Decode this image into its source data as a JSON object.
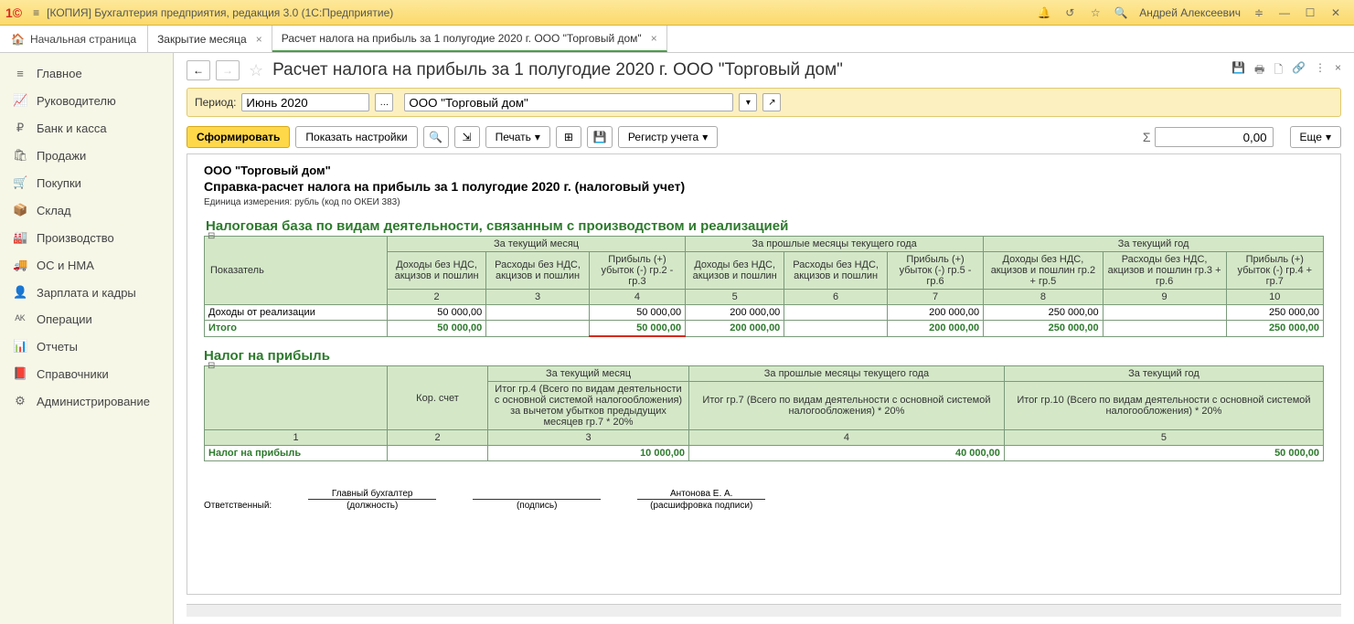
{
  "titlebar": {
    "title": "[КОПИЯ] Бухгалтерия предприятия, редакция 3.0  (1С:Предприятие)",
    "user": "Андрей Алексеевич"
  },
  "tabs": {
    "home": "Начальная страница",
    "items": [
      {
        "label": "Закрытие месяца",
        "active": false
      },
      {
        "label": "Расчет налога на прибыль за 1 полугодие 2020 г. ООО \"Торговый дом\"",
        "active": true
      }
    ]
  },
  "sidebar": [
    {
      "icon": "≡",
      "label": "Главное"
    },
    {
      "icon": "📈",
      "label": "Руководителю"
    },
    {
      "icon": "₽",
      "label": "Банк и касса"
    },
    {
      "icon": "🛍",
      "label": "Продажи"
    },
    {
      "icon": "🛒",
      "label": "Покупки"
    },
    {
      "icon": "📦",
      "label": "Склад"
    },
    {
      "icon": "🏭",
      "label": "Производство"
    },
    {
      "icon": "🚚",
      "label": "ОС и НМА"
    },
    {
      "icon": "👤",
      "label": "Зарплата и кадры"
    },
    {
      "icon": "ᴬᴷ",
      "label": "Операции"
    },
    {
      "icon": "📊",
      "label": "Отчеты"
    },
    {
      "icon": "📕",
      "label": "Справочники"
    },
    {
      "icon": "⚙",
      "label": "Администрирование"
    }
  ],
  "page": {
    "title": "Расчет налога на прибыль за 1 полугодие 2020 г. ООО \"Торговый дом\""
  },
  "filter": {
    "period_label": "Период:",
    "period_value": "Июнь 2020",
    "org_value": "ООО \"Торговый дом\""
  },
  "toolbar": {
    "form": "Сформировать",
    "settings": "Показать настройки",
    "print": "Печать",
    "register": "Регистр учета",
    "sigma_value": "0,00",
    "more": "Еще"
  },
  "report": {
    "org": "ООО \"Торговый дом\"",
    "title": "Справка-расчет налога на прибыль за 1 полугодие 2020 г. (налоговый учет)",
    "unit_label": "Единица измерения:",
    "unit_value": "рубль (код по ОКЕИ 383)",
    "section1": {
      "title": "Налоговая база по видам деятельности, связанным с производством и реализацией",
      "h_indicator": "Показатель",
      "h_cur_month": "За текущий месяц",
      "h_prev_months": "За прошлые месяцы текущего года",
      "h_cur_year": "За текущий год",
      "c1": "Доходы без НДС, акцизов и пошлин",
      "c2": "Расходы без НДС, акцизов и пошлин",
      "c3": "Прибыль (+) убыток (-) гр.2 - гр.3",
      "c4": "Доходы без НДС, акцизов и пошлин",
      "c5": "Расходы без НДС, акцизов и пошлин",
      "c6": "Прибыль (+) убыток (-) гр.5 - гр.6",
      "c7": "Доходы без НДС, акцизов и пошлин гр.2 + гр.5",
      "c8": "Расходы без НДС, акцизов и пошлин гр.3 + гр.6",
      "c9": "Прибыль (+) убыток (-) гр.4 + гр.7",
      "n2": "2",
      "n3": "3",
      "n4": "4",
      "n5": "5",
      "n6": "6",
      "n7": "7",
      "n8": "8",
      "n9": "9",
      "n10": "10",
      "row1_label": "Доходы от реализации",
      "row1": {
        "v2": "50 000,00",
        "v3": "",
        "v4": "50 000,00",
        "v5": "200 000,00",
        "v6": "",
        "v7": "200 000,00",
        "v8": "250 000,00",
        "v9": "",
        "v10": "250 000,00"
      },
      "total_label": "Итого",
      "total": {
        "v2": "50 000,00",
        "v3": "",
        "v4": "50 000,00",
        "v5": "200 000,00",
        "v6": "",
        "v7": "200 000,00",
        "v8": "250 000,00",
        "v9": "",
        "v10": "250 000,00"
      }
    },
    "section2": {
      "title": "Налог на прибыль",
      "h_cur_month": "За текущий месяц",
      "h_prev_months": "За прошлые месяцы текущего года",
      "h_cur_year": "За текущий год",
      "c_kor": "Кор. счет",
      "c_cur": "Итог гр.4 (Всего по видам деятельности с основной системой налогообложения) за вычетом убытков предыдущих месяцев гр.7 * 20%",
      "c_prev": "Итог гр.7 (Всего по видам деятельности с основной системой налогообложения) * 20%",
      "c_year": "Итог гр.10 (Всего по видам деятельности с основной системой налогообложения) * 20%",
      "n1": "1",
      "n2": "2",
      "n3": "3",
      "n4": "4",
      "n5": "5",
      "row_label": "Налог на прибыль",
      "row": {
        "v2": "",
        "v3": "10 000,00",
        "v4": "40 000,00",
        "v5": "50 000,00"
      }
    },
    "sig": {
      "resp": "Ответственный:",
      "acc": "Главный бухгалтер",
      "pos": "(должность)",
      "sign": "(подпись)",
      "name": "Антонова Е. А.",
      "decode": "(расшифровка подписи)"
    }
  }
}
